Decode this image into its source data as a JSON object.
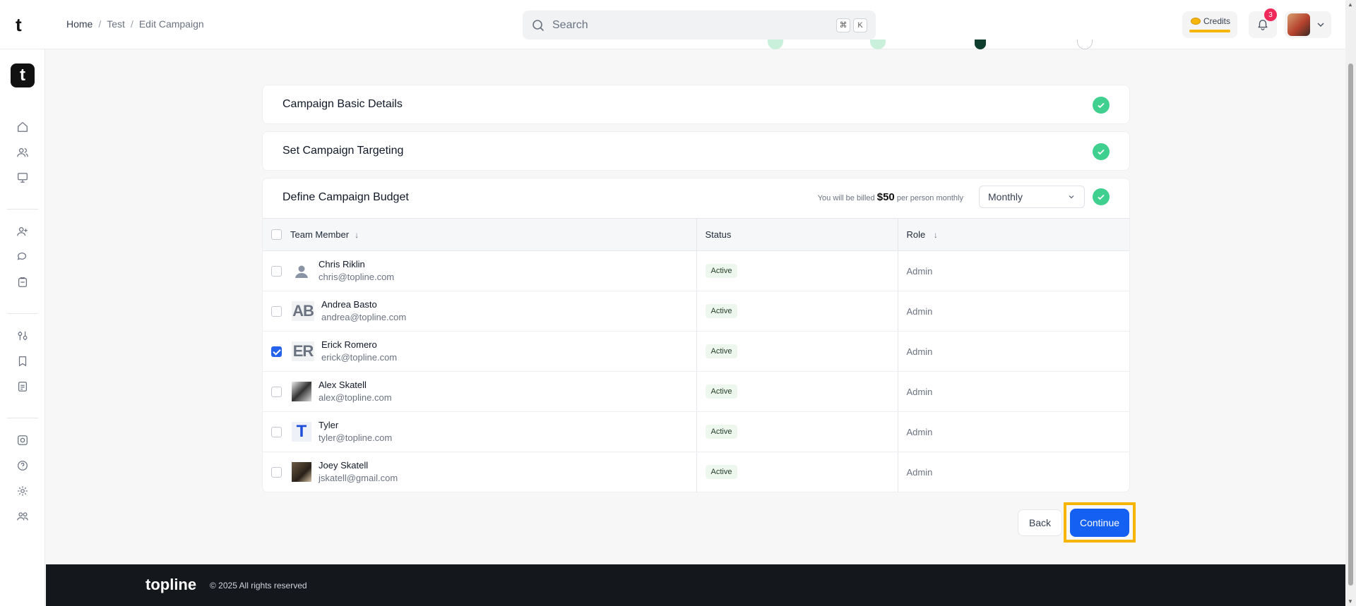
{
  "header": {
    "brand_letter": "t",
    "breadcrumb": [
      "Home",
      "Test",
      "Edit Campaign"
    ],
    "search": {
      "placeholder": "Search",
      "shortcut": [
        "⌘",
        "K"
      ]
    },
    "credits_label": "Credits",
    "notifications_count": "3"
  },
  "sidebar": {
    "logo_letter": "t",
    "icons": [
      "home-icon",
      "users-icon",
      "monitor-icon",
      "add-user-icon",
      "chat-icon",
      "clipboard-icon",
      "sliders-icon",
      "bookmark-icon",
      "document-icon",
      "integrations-icon",
      "help-icon",
      "settings-icon",
      "team-icon"
    ]
  },
  "steps": [
    {
      "state": "done",
      "color": "#3fcf8e"
    },
    {
      "state": "done",
      "color": "#3fcf8e"
    },
    {
      "state": "current",
      "color": "#0f3d2e"
    },
    {
      "state": "pending",
      "color": "#d1d5db"
    }
  ],
  "sections": {
    "basic": "Campaign Basic Details",
    "targeting": "Set Campaign Targeting",
    "budget": "Define Campaign Budget"
  },
  "budget": {
    "billed_prefix": "You will be billed",
    "billed_amount": "$50",
    "billed_suffix": "per person monthly",
    "frequency": "Monthly"
  },
  "table": {
    "headers": {
      "member": "Team Member",
      "status": "Status",
      "role": "Role"
    },
    "rows": [
      {
        "name": "Chris Riklin",
        "email": "chris@topline.com",
        "status": "Active",
        "role": "Admin",
        "checked": false,
        "avatar": "placeholder"
      },
      {
        "name": "Andrea Basto",
        "email": "andrea@topline.com",
        "status": "Active",
        "role": "Admin",
        "checked": false,
        "avatar": "initials",
        "initials": "AB"
      },
      {
        "name": "Erick Romero",
        "email": "erick@topline.com",
        "status": "Active",
        "role": "Admin",
        "checked": true,
        "avatar": "initials",
        "initials": "ER"
      },
      {
        "name": "Alex Skatell",
        "email": "alex@topline.com",
        "status": "Active",
        "role": "Admin",
        "checked": false,
        "avatar": "photo1"
      },
      {
        "name": "Tyler",
        "email": "tyler@topline.com",
        "status": "Active",
        "role": "Admin",
        "checked": false,
        "avatar": "letter",
        "initials": "T"
      },
      {
        "name": "Joey Skatell",
        "email": "jskatell@gmail.com",
        "status": "Active",
        "role": "Admin",
        "checked": false,
        "avatar": "photo2"
      }
    ]
  },
  "actions": {
    "back": "Back",
    "continue": "Continue"
  },
  "footer": {
    "logo": "topline",
    "copyright": "© 2025 All rights reserved"
  },
  "colors": {
    "accent": "#1460f2",
    "success": "#3fcf8e",
    "focus_outline": "#f7b500",
    "badge": "#ef2a5a"
  }
}
